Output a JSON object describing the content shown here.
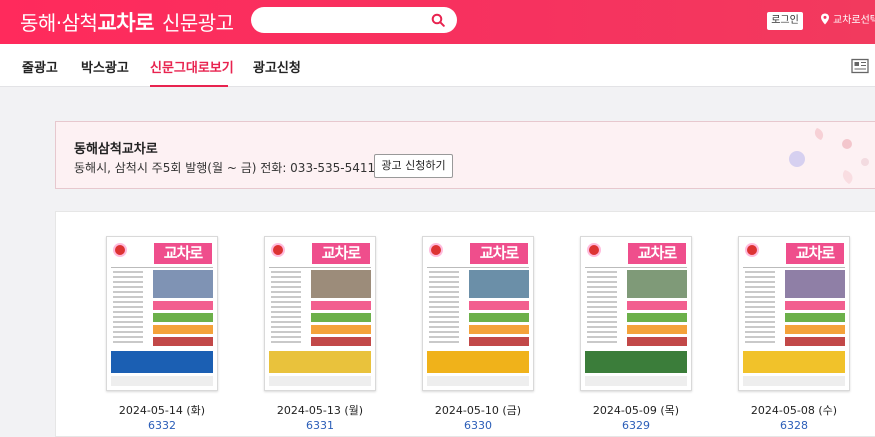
{
  "header": {
    "brand_prefix": "동해·삼척",
    "brand_strong": "교차로",
    "brand_suffix": "신문광고",
    "search_icon": "search-icon",
    "login_label": "로그인",
    "region_label": "교차로선택",
    "region_icon": "location-pin-icon",
    "colors": {
      "brand": "#f6325f",
      "accent": "#e8234f"
    }
  },
  "nav": {
    "items": [
      {
        "label": "줄광고",
        "active": false
      },
      {
        "label": "박스광고",
        "active": false
      },
      {
        "label": "신문그대로보기",
        "active": true
      },
      {
        "label": "광고신청",
        "active": false
      }
    ],
    "list_icon": "newspaper-list-icon"
  },
  "info": {
    "title": "동해삼척교차로",
    "description": "동해시, 삼척시 주5회 발행(월 ~ 금) 전화: 033-535-5411",
    "apply_label": "광고 신청하기"
  },
  "papers": [
    {
      "date": "2024-05-14 (화)",
      "issue": "6332",
      "banner_color": "#1b5fb3",
      "masthead": "교차로"
    },
    {
      "date": "2024-05-13 (월)",
      "issue": "6331",
      "banner_color": "#e9c23c",
      "masthead": "교차로"
    },
    {
      "date": "2024-05-10 (금)",
      "issue": "6330",
      "banner_color": "#f0b21a",
      "masthead": "교차로"
    },
    {
      "date": "2024-05-09 (목)",
      "issue": "6329",
      "banner_color": "#3b7d3a",
      "masthead": "교차로"
    },
    {
      "date": "2024-05-08 (수)",
      "issue": "6328",
      "banner_color": "#f1c22a",
      "masthead": "교차로"
    }
  ]
}
